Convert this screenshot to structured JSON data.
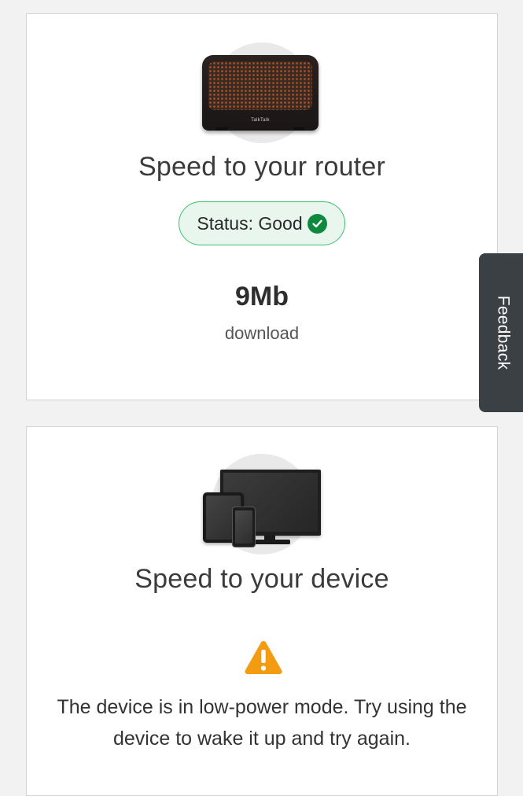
{
  "router_card": {
    "title": "Speed to your router",
    "router_brand": "TalkTalk",
    "status_label": "Status: Good",
    "speed_value": "9Mb",
    "speed_unit_label": "download",
    "status_color": "#0e8a3e",
    "icon": "check-circle-icon"
  },
  "device_card": {
    "title": "Speed to your device",
    "warning_icon": "warning-icon",
    "warning_color": "#f39c12",
    "message": "The device is in low-power mode. Try using the device to wake it up and try again."
  },
  "feedback_tab": {
    "label": "Feedback"
  }
}
